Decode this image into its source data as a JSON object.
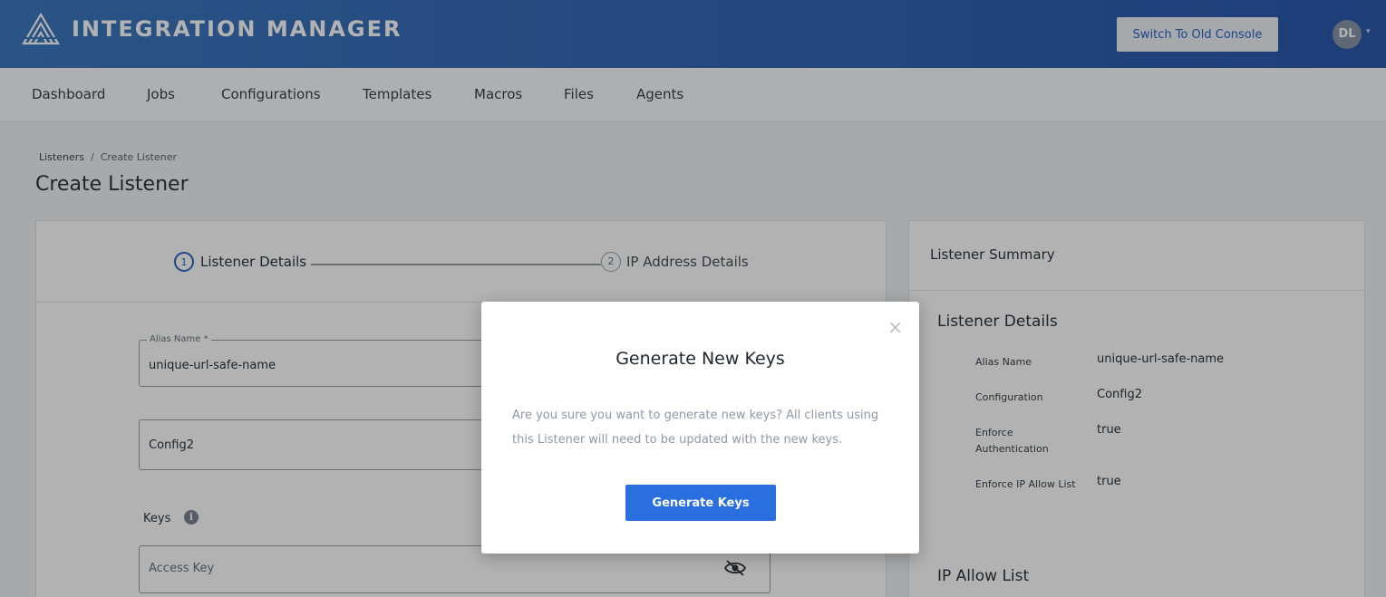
{
  "header": {
    "brand": "INTEGRATION MANAGER",
    "switch_button": "Switch To Old Console",
    "avatar_initials": "DL",
    "logo_icon": "integration-manager-logo",
    "colors": {
      "header_bg": "#3366b4",
      "accent": "#2d63c6"
    }
  },
  "nav": {
    "items": [
      {
        "label": "Dashboard"
      },
      {
        "label": "Jobs"
      },
      {
        "label": "Configurations"
      },
      {
        "label": "Templates"
      },
      {
        "label": "Macros"
      },
      {
        "label": "Files"
      },
      {
        "label": "Agents"
      }
    ]
  },
  "breadcrumb": {
    "parent": "Listeners",
    "separator": "/",
    "current": "Create Listener"
  },
  "page": {
    "title": "Create Listener"
  },
  "stepper": {
    "steps": [
      {
        "number": "1",
        "label": "Listener Details",
        "state": "active"
      },
      {
        "number": "2",
        "label": "IP Address Details",
        "state": "inactive"
      }
    ]
  },
  "form": {
    "alias": {
      "legend": "Alias Name *",
      "value": "unique-url-safe-name"
    },
    "configuration": {
      "value": "Config2"
    },
    "keys_label": "Keys",
    "info_icon": "i",
    "access_key": {
      "placeholder": "Access Key",
      "icon": "eye-slash-icon"
    }
  },
  "summary": {
    "title": "Listener Summary",
    "details_title": "Listener Details",
    "rows": [
      {
        "label": "Alias Name",
        "value": "unique-url-safe-name"
      },
      {
        "label": "Configuration",
        "value": "Config2"
      },
      {
        "label": "Enforce Authentication",
        "value": "true"
      },
      {
        "label": "Enforce IP Allow List",
        "value": "true"
      }
    ],
    "ip_title": "IP Allow List"
  },
  "modal": {
    "title": "Generate New Keys",
    "body": "Are you sure you want to generate new keys? All clients using this Listener will need to be updated with the new keys.",
    "button": "Generate Keys",
    "close": "×",
    "colors": {
      "primary_button": "#2a6fe0"
    }
  }
}
